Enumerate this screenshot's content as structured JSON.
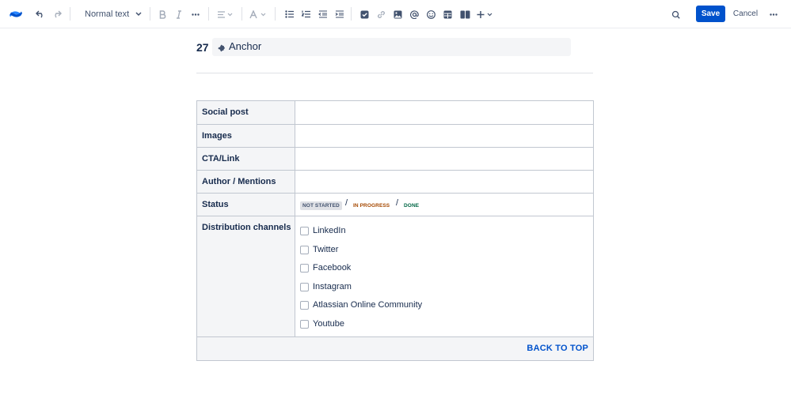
{
  "toolbar": {
    "text_style": "Normal text",
    "save_label": "Save",
    "cancel_label": "Cancel",
    "icons": [
      "confluence-logo-icon",
      "undo-icon",
      "redo-icon",
      "chevron-down-icon",
      "bold-icon",
      "italic-icon",
      "more-formatting-icon",
      "align-icon",
      "text-color-icon",
      "bullet-list-icon",
      "numbered-list-icon",
      "outdent-icon",
      "indent-icon",
      "action-item-icon",
      "link-icon",
      "image-icon",
      "mention-icon",
      "emoji-icon",
      "table-icon",
      "layouts-icon",
      "insert-icon",
      "find-replace-icon",
      "more-icon"
    ],
    "accent_color": "#0052CC"
  },
  "heading": {
    "number": "27",
    "anchor_label": "Anchor"
  },
  "table": {
    "rows": [
      {
        "label": "Social post"
      },
      {
        "label": "Images"
      },
      {
        "label": "CTA/Link"
      },
      {
        "label": "Author / Mentions"
      },
      {
        "label": "Status"
      },
      {
        "label": "Distribution channels"
      }
    ],
    "status": {
      "not_started": "NOT STARTED",
      "in_progress": "IN PROGRESS",
      "done": "DONE",
      "separator": "/"
    },
    "channels": [
      "LinkedIn",
      "Twitter",
      "Facebook",
      "Instagram",
      "Atlassian Online Community",
      "Youtube"
    ],
    "back_to_top": "BACK TO TOP"
  }
}
